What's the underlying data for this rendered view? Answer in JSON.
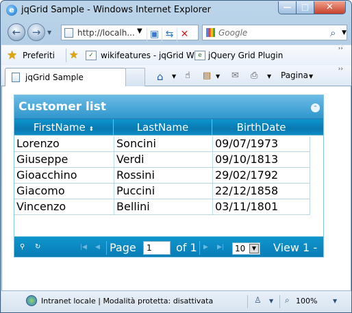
{
  "window": {
    "title": "jqGrid Sample - Windows Internet Explorer",
    "controls": {
      "minimize": "—",
      "maximize": "□",
      "close": "✕"
    }
  },
  "navigation": {
    "address_text": "http://localh...",
    "search_placeholder": "Google"
  },
  "favorites_bar": {
    "favorites_label": "Preferiti",
    "items": [
      "wikifeatures - jqGrid Wiki",
      "jQuery Grid Plugin"
    ]
  },
  "tabs": {
    "active_tab_label": "jqGrid Sample",
    "page_menu_label": "Pagina"
  },
  "grid": {
    "caption": "Customer list",
    "columns": [
      "FirstName",
      "LastName",
      "BirthDate"
    ],
    "sort_indicator": "⬍",
    "rows": [
      [
        "Lorenzo",
        "Soncini",
        "09/07/1973"
      ],
      [
        "Giuseppe",
        "Verdi",
        "09/10/1813"
      ],
      [
        "Gioacchino",
        "Rossini",
        "29/02/1792"
      ],
      [
        "Giacomo",
        "Puccini",
        "22/12/1858"
      ],
      [
        "Vincenzo",
        "Bellini",
        "03/11/1801"
      ]
    ],
    "pager": {
      "page_label": "Page",
      "current_page": "1",
      "of_label": "of 1",
      "rows_per_page": "10",
      "view_text": "View 1 -"
    }
  },
  "status_bar": {
    "zone_text": "Intranet locale | Modalità protetta: disattivata",
    "zoom": "100%"
  }
}
